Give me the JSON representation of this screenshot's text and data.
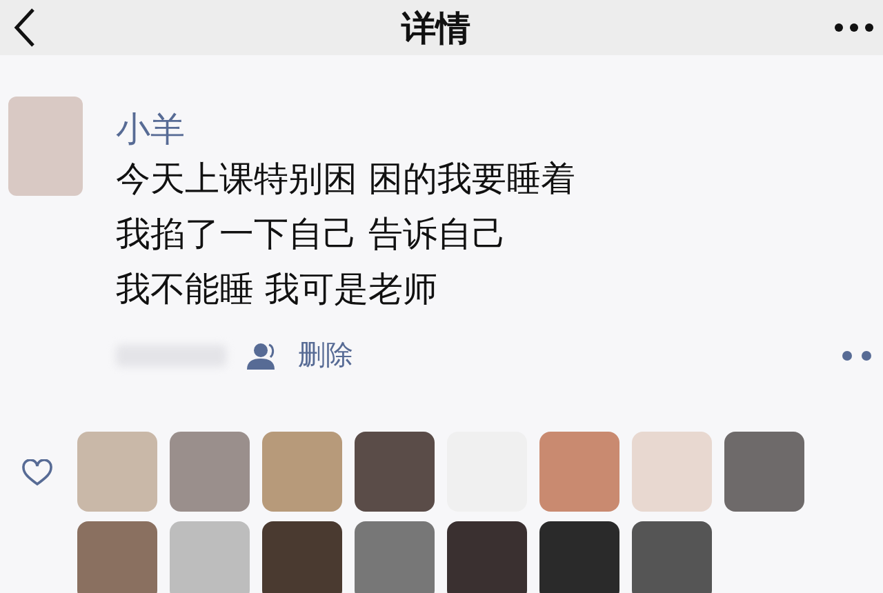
{
  "header": {
    "title": "详情"
  },
  "post": {
    "author": "小羊",
    "lines": [
      "今天上课特别困 困的我要睡着",
      "我掐了一下自己 告诉自己",
      "我不能睡 我可是老师"
    ],
    "delete_label": "删除"
  }
}
